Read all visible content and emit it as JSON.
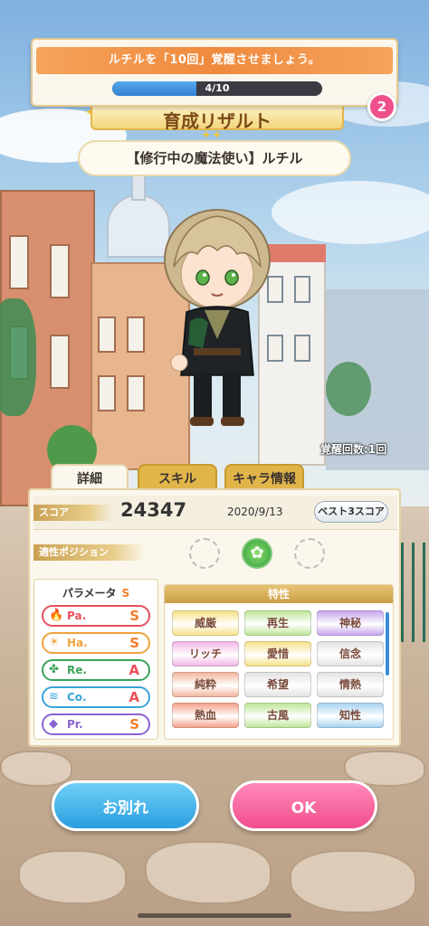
{
  "mission": {
    "text": "ルチルを「10回」覚醒させましょう。",
    "progress_text": "4/10",
    "progress_fraction": 0.4,
    "badge_count": "2"
  },
  "header": {
    "title": "育成リザルト",
    "card_name": "【修行中の魔法使い】ルチル",
    "awaken_count": "覚醒回数:1回"
  },
  "tabs": [
    {
      "label": "詳細"
    },
    {
      "label": "スキル"
    },
    {
      "label": "キャラ情報"
    }
  ],
  "score": {
    "label": "スコア",
    "value": "24347",
    "date": "2020/9/13",
    "best_button": "ベスト3スコア"
  },
  "position": {
    "label": "適性ポジション"
  },
  "params": {
    "title": "パラメータ",
    "rank": "S",
    "items": [
      {
        "name": "Pa.",
        "rank": "S",
        "icon": "flame-icon",
        "color": "#e8505b"
      },
      {
        "name": "Ha.",
        "rank": "S",
        "icon": "sun-icon",
        "color": "#f0a23a"
      },
      {
        "name": "Re.",
        "rank": "A",
        "icon": "clover-icon",
        "color": "#3aa35a"
      },
      {
        "name": "Co.",
        "rank": "A",
        "icon": "wave-icon",
        "color": "#3aa4d8"
      },
      {
        "name": "Pr.",
        "rank": "S",
        "icon": "diamond-icon",
        "color": "#8a63d2"
      }
    ]
  },
  "traits": {
    "title": "特性",
    "items": [
      {
        "label": "威厳",
        "color": "#f6e28a"
      },
      {
        "label": "再生",
        "color": "#bfe69b"
      },
      {
        "label": "神秘",
        "color": "#c7a7ef"
      },
      {
        "label": "リッチ",
        "color": "#f2b7e6"
      },
      {
        "label": "愛惜",
        "color": "#f6e28a"
      },
      {
        "label": "信念",
        "color": "#e3e3e3"
      },
      {
        "label": "純粋",
        "color": "#f2b7a0"
      },
      {
        "label": "希望",
        "color": "#e3e3e3"
      },
      {
        "label": "情熱",
        "color": "#e3e3e3"
      },
      {
        "label": "熱血",
        "color": "#f5a38e"
      },
      {
        "label": "古風",
        "color": "#bfe69b"
      },
      {
        "label": "知性",
        "color": "#a9d3f2"
      }
    ]
  },
  "buttons": {
    "farewell": "お別れ",
    "ok": "OK"
  }
}
